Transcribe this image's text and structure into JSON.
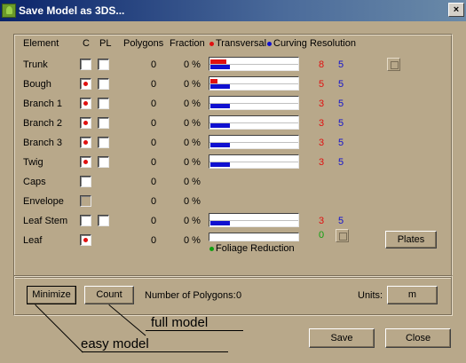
{
  "window": {
    "title": "Save Model as 3DS...",
    "close_glyph": "×"
  },
  "headers": {
    "element": "Element",
    "c": "C",
    "pl": "PL",
    "polygons": "Polygons",
    "fraction": "Fraction",
    "transversal": "Transversal",
    "curving": "Curving Resolution"
  },
  "rows": [
    {
      "name": "Trunk",
      "c": false,
      "pl": false,
      "polygons": "0",
      "fraction": "0 %",
      "bar": true,
      "red_fill": 0.18,
      "blue_fill": 0.22,
      "red_val": "8",
      "blue_val": "5",
      "side_button": true
    },
    {
      "name": "Bough",
      "c": true,
      "pl": false,
      "polygons": "0",
      "fraction": "0 %",
      "bar": true,
      "red_fill": 0.08,
      "blue_fill": 0.22,
      "red_val": "5",
      "blue_val": "5"
    },
    {
      "name": "Branch 1",
      "c": true,
      "pl": false,
      "polygons": "0",
      "fraction": "0 %",
      "bar": true,
      "red_fill": 0,
      "blue_fill": 0.22,
      "red_val": "3",
      "blue_val": "5"
    },
    {
      "name": "Branch 2",
      "c": true,
      "pl": false,
      "polygons": "0",
      "fraction": "0 %",
      "bar": true,
      "red_fill": 0,
      "blue_fill": 0.22,
      "red_val": "3",
      "blue_val": "5"
    },
    {
      "name": "Branch 3",
      "c": true,
      "pl": false,
      "polygons": "0",
      "fraction": "0 %",
      "bar": true,
      "red_fill": 0,
      "blue_fill": 0.22,
      "red_val": "3",
      "blue_val": "5"
    },
    {
      "name": "Twig",
      "c": true,
      "pl": false,
      "polygons": "0",
      "fraction": "0 %",
      "bar": true,
      "red_fill": 0,
      "blue_fill": 0.22,
      "red_val": "3",
      "blue_val": "5"
    },
    {
      "name": "Caps",
      "c": false,
      "pl": null,
      "polygons": "0",
      "fraction": "0 %",
      "bar": false
    },
    {
      "name": "Envelope",
      "c": "disabled",
      "pl": null,
      "polygons": "0",
      "fraction": "0 %",
      "bar": false
    },
    {
      "name": "Leaf Stem",
      "c": false,
      "pl": false,
      "polygons": "0",
      "fraction": "0 %",
      "bar": true,
      "red_fill": 0,
      "blue_fill": 0.22,
      "red_val": "3",
      "blue_val": "5"
    },
    {
      "name": "Leaf",
      "c": true,
      "pl": null,
      "polygons": "0",
      "fraction": "0 %",
      "bar": true,
      "single": true,
      "green_val": "0",
      "side_small": true
    }
  ],
  "foliage_reduction": "Foliage Reduction",
  "buttons": {
    "plates": "Plates",
    "minimize": "Minimize",
    "count": "Count",
    "units": "m",
    "save": "Save",
    "close": "Close"
  },
  "polygon_count_label": "Number of Polygons:",
  "polygon_count_value": "0",
  "units_label": "Units:",
  "annotations": {
    "full_model": "full model",
    "easy_model": "easy model"
  },
  "colors": {
    "red": "#e01010",
    "blue": "#1010d0",
    "green": "#10a010"
  }
}
